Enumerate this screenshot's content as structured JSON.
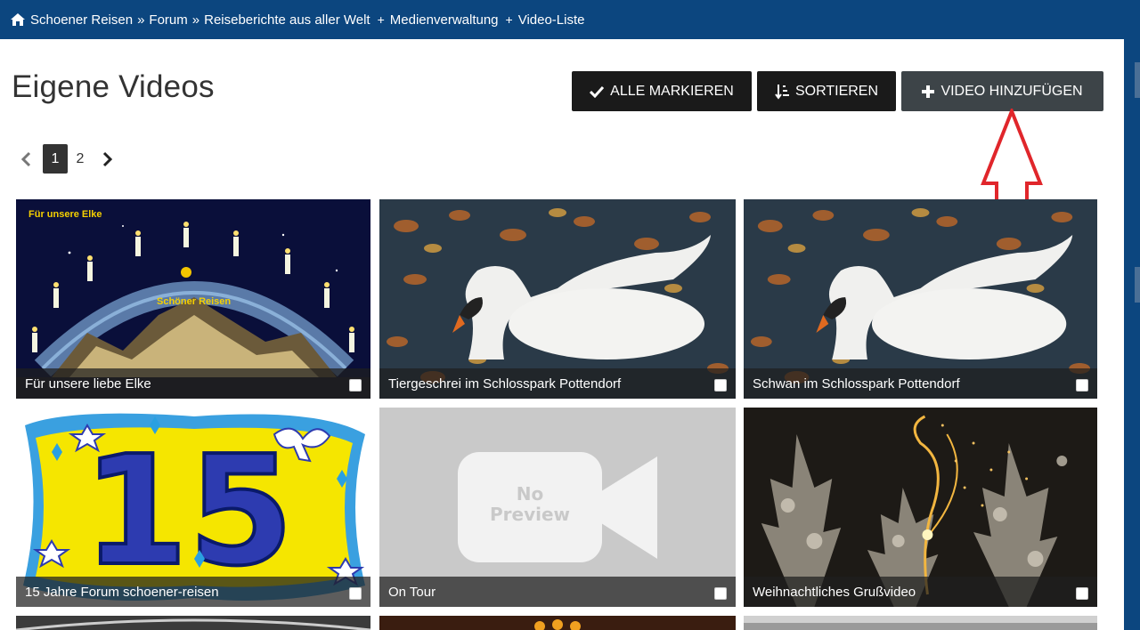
{
  "breadcrumb": {
    "home_label": "Schoener Reisen",
    "sep1": "»",
    "item2": "Forum",
    "sep2": "»",
    "item3": "Reiseberichte aus aller Welt",
    "plus1": "+",
    "item4": "Medienverwaltung",
    "plus2": "+",
    "item5": "Video-Liste"
  },
  "page": {
    "title": "Eigene Videos"
  },
  "toolbar": {
    "mark_all": "ALLE MARKIEREN",
    "sort": "SORTIEREN",
    "add_video": "VIDEO HINZUFÜGEN"
  },
  "pagination": {
    "pages": [
      "1",
      "2"
    ],
    "active": "1"
  },
  "videos": [
    {
      "title": "Für unsere liebe Elke",
      "thumb_text_1": "Für unsere Elke",
      "thumb_text_2": "Schöner Reisen"
    },
    {
      "title": "Tiergeschrei im Schlosspark Pottendorf"
    },
    {
      "title": "Schwan im Schlosspark Pottendorf"
    },
    {
      "title": "15 Jahre Forum schoener-reisen",
      "thumb_text": "15"
    },
    {
      "title": "On Tour",
      "thumb_text_1": "No",
      "thumb_text_2": "Preview"
    },
    {
      "title": "Weihnachtliches Grußvideo"
    }
  ],
  "colors": {
    "topbar": "#0c467f",
    "button_dark": "#1a1a1a",
    "button_add": "#3d4448",
    "annotation_arrow": "#e0262b"
  }
}
